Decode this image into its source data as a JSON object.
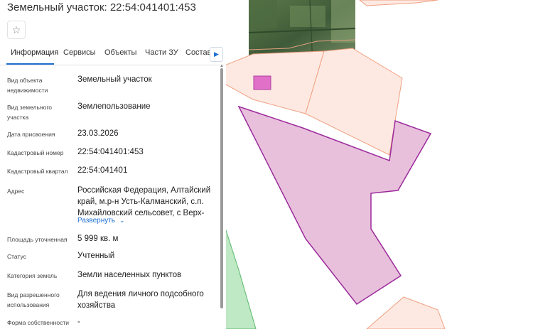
{
  "title": "Земельный участок: 22:54:041401:453",
  "tabs": [
    {
      "label": "Информация",
      "active": true
    },
    {
      "label": "Сервисы"
    },
    {
      "label": "Объекты"
    },
    {
      "label": "Части ЗУ"
    },
    {
      "label": "Состав"
    }
  ],
  "fields": {
    "object_type": {
      "label": "Вид объекта недвижимости",
      "value": "Земельный участок"
    },
    "plot_type": {
      "label": "Вид земельного участка",
      "value": "Землепользование"
    },
    "assign_date": {
      "label": "Дата присвоения",
      "value": "23.03.2026"
    },
    "cadastral_number": {
      "label": "Кадастровый номер",
      "value": "22:54:041401:453"
    },
    "cadastral_quarter": {
      "label": "Кадастровый квартал",
      "value": "22:54:041401"
    },
    "address": {
      "label": "Адрес",
      "value": "Российская Федерация, Алтайский край, м.р-н Усть-Калманский, с.п. Михайловский сельсовет, с Верх-",
      "expand_label": "Развернуть"
    },
    "area": {
      "label": "Площадь уточненная",
      "value": "5 999 кв. м"
    },
    "status": {
      "label": "Статус",
      "value": "Учтенный"
    },
    "land_category": {
      "label": "Категория земель",
      "value": "Земли населенных пунктов"
    },
    "permitted_use": {
      "label": "Вид разрешенного использования",
      "value": "Для ведения личного подсобного хозяйства"
    },
    "ownership": {
      "label": "Форма собственности",
      "value": "-"
    }
  },
  "map": {
    "colors": {
      "parcel_fill": "#fde9e2",
      "parcel_stroke": "#f0a080",
      "selected_fill": "#e8c0dc",
      "selected_stroke": "#9c2a9c",
      "building_fill": "#e070c8",
      "green_fill": "#bfe8c4",
      "green_stroke": "#58b86a"
    }
  }
}
